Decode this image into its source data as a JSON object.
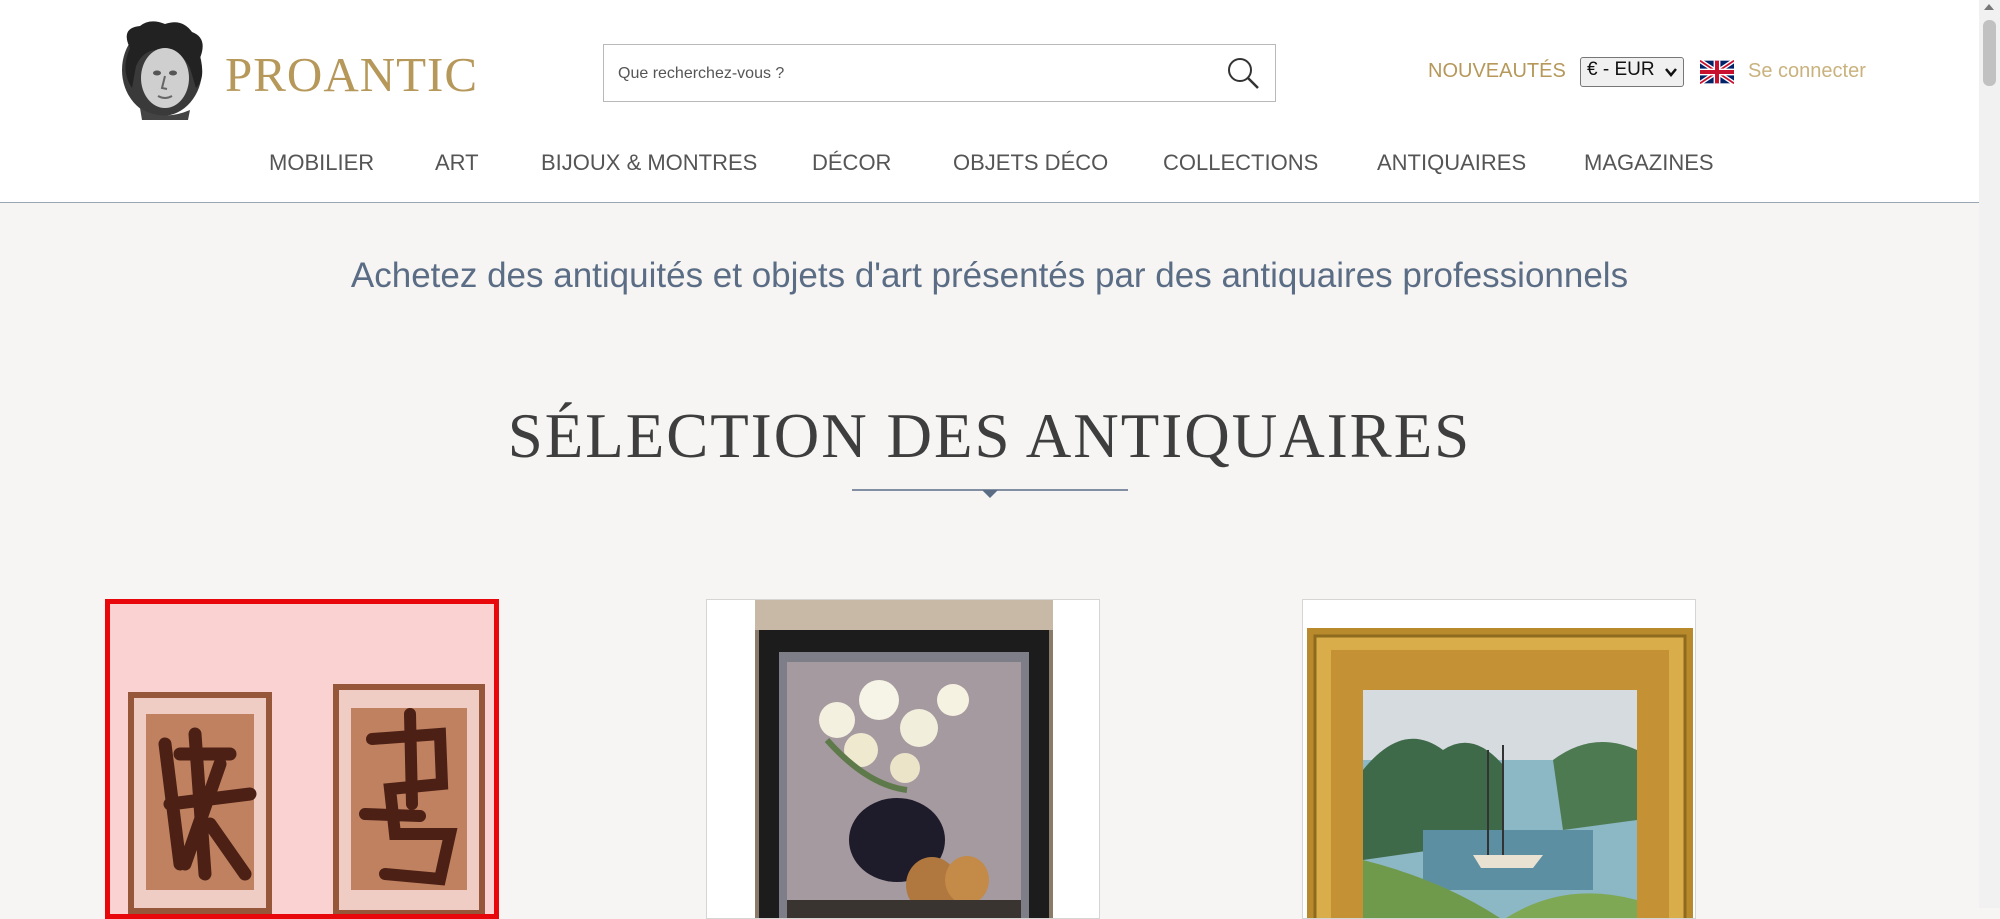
{
  "header": {
    "logo_text": "PROANTIC",
    "search": {
      "placeholder": "Que recherchez-vous ?",
      "value": ""
    },
    "nouveautes_label": "NOUVEAUTÉS",
    "currency": "€ - EUR",
    "login_label": "Se connecter"
  },
  "nav": {
    "items": [
      {
        "label": "MOBILIER"
      },
      {
        "label": "ART"
      },
      {
        "label": "BIJOUX & MONTRES"
      },
      {
        "label": "DÉCOR"
      },
      {
        "label": "OBJETS DÉCO"
      },
      {
        "label": "COLLECTIONS"
      },
      {
        "label": "ANTIQUAIRES"
      },
      {
        "label": "MAGAZINES"
      }
    ]
  },
  "main": {
    "tagline": "Achetez des antiquités et objets d'art présentés par des antiquaires professionnels",
    "section_title": "SÉLECTION DES ANTIQUAIRES"
  },
  "icons": {
    "logo": "bust-icon",
    "search": "search-icon",
    "language": "uk-flag-icon",
    "currency_caret": "chevron-down-icon"
  },
  "colors": {
    "brand_gold": "#b5985a",
    "tagline_blue": "#5b6d85",
    "selection_red": "#e8070b",
    "page_background": "#f6f5f4"
  }
}
